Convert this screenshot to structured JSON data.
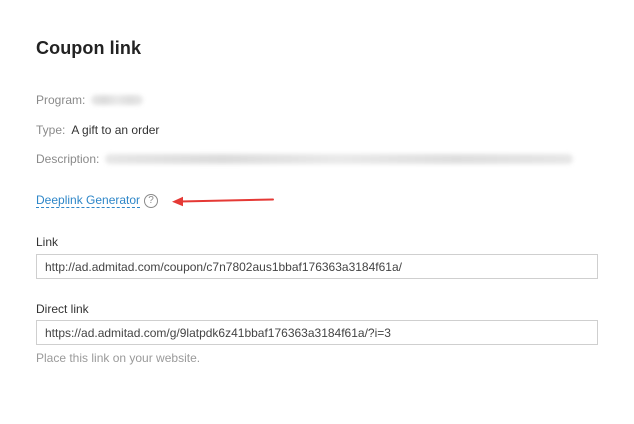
{
  "page_title": "Coupon link",
  "program": {
    "label": "Program:"
  },
  "type": {
    "label": "Type:",
    "value": "A gift to an order"
  },
  "description": {
    "label": "Description:"
  },
  "deeplink": {
    "label": "Deeplink Generator",
    "help_icon": "question-circle-icon",
    "help_glyph": "?"
  },
  "annotation": {
    "icon": "red-arrow-icon",
    "color": "#e53935"
  },
  "link_field": {
    "label": "Link",
    "value": "http://ad.admitad.com/coupon/c7n7802aus1bbaf176363a3184f61a/"
  },
  "direct_link_field": {
    "label": "Direct link",
    "value": "https://ad.admitad.com/g/9latpdk6z41bbaf176363a3184f61a/?i=3",
    "hint": "Place this link on your website."
  },
  "colors": {
    "link": "#2d86c8",
    "label_muted": "#8a8a8a",
    "border": "#cfcfcf"
  }
}
